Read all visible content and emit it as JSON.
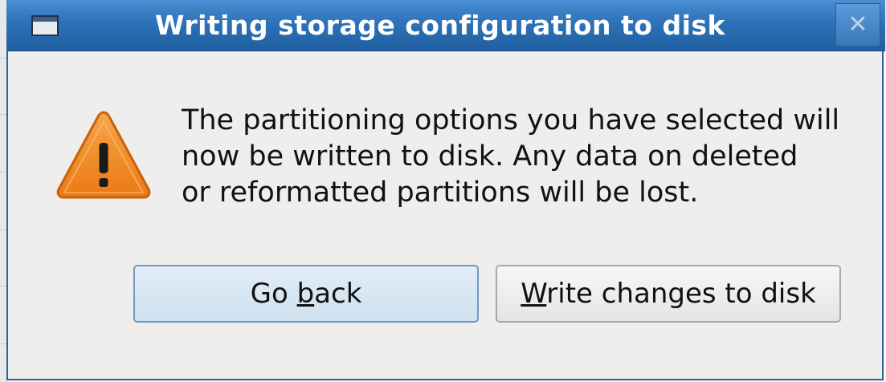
{
  "dialog": {
    "title": "Writing storage configuration to disk",
    "close_glyph": "✕",
    "message": "The partitioning options you have selected will\nnow be written to disk.  Any data on deleted\nor reformatted partitions will be lost.",
    "warning_icon": "warning-triangle-icon",
    "buttons": {
      "back": {
        "pre": "Go ",
        "mnemonic": "b",
        "post": "ack"
      },
      "write": {
        "pre": "",
        "mnemonic": "W",
        "post": "rite changes to disk"
      }
    }
  },
  "colors": {
    "titlebar": "#2d72b8",
    "window_bg": "#efeeed",
    "warning_orange": "#f08a24",
    "default_button_border": "#6f98c2"
  }
}
